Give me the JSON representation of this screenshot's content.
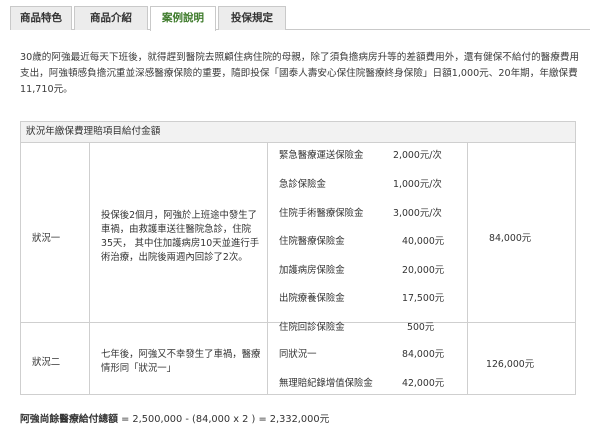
{
  "tabs": [
    {
      "label": "商品特色"
    },
    {
      "label": "商品介紹"
    },
    {
      "label": "案例說明"
    },
    {
      "label": "投保規定"
    }
  ],
  "intro": {
    "text": "30歲的阿強最近每天下班後，就得趕到醫院去照顧住病住院的母親，除了須負擔病房升等的差額費用外，還有健保不給付的醫療費用支出，阿強頓感負擔沉重並深感醫療保險的重要，隨即投保「國泰人壽安心保住院醫療終身保險」日額1,000元、20年期，年繳保費11,710元。"
  },
  "table": {
    "heading": "狀況年繳保費理賠項目給付金額",
    "cases": [
      {
        "name": "狀況一",
        "desc": "投保後2個月，阿強於上班途中發生了車禍，由救護車送往醫院急診，住院35天， 其中住加護病房10天並進行手術治療，出院後兩週內回診了2次。",
        "total": "84,000元"
      },
      {
        "name": "狀況二",
        "desc": "七年後，阿強又不幸發生了車禍，醫療情形同「狀況一」",
        "total": "126,000元"
      }
    ],
    "items": [
      {
        "label": "緊急醫療運送保險金",
        "amount": "2,000元/次"
      },
      {
        "label": "急診保險金",
        "amount": "1,000元/次"
      },
      {
        "label": "住院手術醫療保險金",
        "amount": "3,000元/次"
      },
      {
        "label": "住院醫療保險金",
        "amount": "40,000元"
      },
      {
        "label": "加護病房保險金",
        "amount": "20,000元"
      },
      {
        "label": "出院療養保險金",
        "amount": "17,500元"
      },
      {
        "label": "住院回診保險金",
        "amount": "500元"
      },
      {
        "label": "同狀況一",
        "amount": "84,000元"
      },
      {
        "label": "無理賠紀錄增值保險金",
        "amount": "42,000元"
      }
    ]
  },
  "footer": {
    "label": "阿強尚餘醫療給付總額",
    "formula": " = 2,500,000 - (84,000 x 2 ) = 2,332,000元"
  }
}
